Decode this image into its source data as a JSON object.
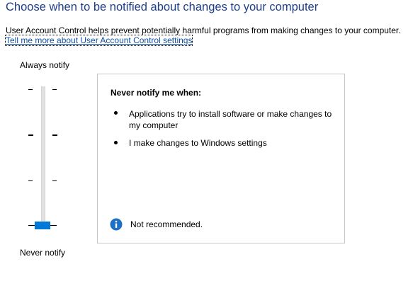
{
  "header": {
    "title": "Choose when to be notified about changes to your computer",
    "description": "User Account Control helps prevent potentially harmful programs from making changes to your computer.",
    "learn_more_link": "Tell me more about User Account Control settings"
  },
  "slider": {
    "top_label": "Always notify",
    "bottom_label": "Never notify",
    "levels": 4,
    "selected_level": 1,
    "accent_color": "#0078d7"
  },
  "panel": {
    "heading": "Never notify me when:",
    "bullets": [
      "Applications try to install software or make changes to my computer",
      "I make changes to Windows settings"
    ],
    "info_icon": "info-icon",
    "info_text": "Not recommended.",
    "info_color": "#1e6fc6"
  }
}
